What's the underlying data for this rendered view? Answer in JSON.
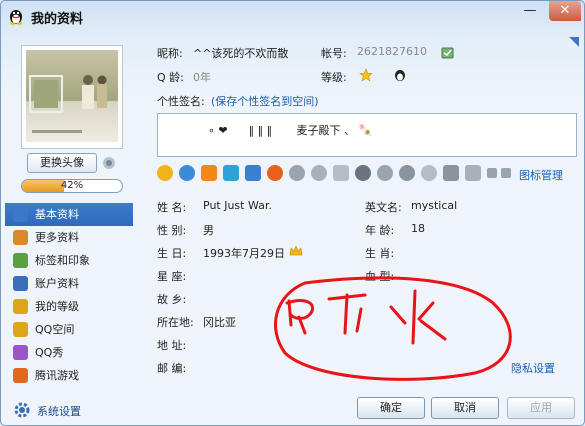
{
  "window": {
    "title": "我的资料"
  },
  "titlebar": {
    "minimize": "—",
    "close": "✕"
  },
  "sidebar": {
    "change_avatar": "更换头像",
    "completion_value": 0.42,
    "completion_text": "42%",
    "items": [
      {
        "label": "基本资料",
        "active": true,
        "icon": "id-card-icon",
        "color": "#3a78c8"
      },
      {
        "label": "更多资料",
        "active": false,
        "icon": "card-icon",
        "color": "#d88a2a"
      },
      {
        "label": "标签和印象",
        "active": false,
        "icon": "tag-icon",
        "color": "#5aa03c"
      },
      {
        "label": "账户资料",
        "active": false,
        "icon": "account-icon",
        "color": "#3a6fb5"
      },
      {
        "label": "我的等级",
        "active": false,
        "icon": "crown-icon",
        "color": "#e0a41a"
      },
      {
        "label": "QQ空间",
        "active": false,
        "icon": "qzone-icon",
        "color": "#e0a41a"
      },
      {
        "label": "QQ秀",
        "active": false,
        "icon": "qqshow-icon",
        "color": "#9a55c8"
      },
      {
        "label": "腾讯游戏",
        "active": false,
        "icon": "game-icon",
        "color": "#e06a1a"
      }
    ],
    "settings_label": "系统设置"
  },
  "profile": {
    "nickname_label": "昵称:",
    "nickname": "^^该死的不欢而散",
    "account_label": "帐号:",
    "account": "2621827610",
    "qage_label": "Q 龄:",
    "qage": "0年",
    "level_label": "等级:",
    "signature_label": "个性签名:",
    "signature_link": "(保存个性签名到空间)",
    "signature_text": "∘ ❤      ‖ ‖ ‖       麦子殿下 、 🍡"
  },
  "icon_manager": "图标管理",
  "fields": {
    "name_label": "姓    名:",
    "name": "Put Just War.",
    "english_label": "英文名:",
    "english": "mystical",
    "gender_label": "性    别:",
    "gender": "男",
    "age_label": "年    龄:",
    "age": "18",
    "birthday_label": "生    日:",
    "birthday": "1993年7月29日",
    "zodiac_label": "生    肖:",
    "zodiac": "",
    "star_label": "星    座:",
    "star": "",
    "blood_label": "血    型:",
    "blood": "",
    "hometown_label": "故    乡:",
    "hometown": "",
    "location_label": "所在地:",
    "location": "冈比亚",
    "address_label": "地    址:",
    "address": "",
    "zip_label": "邮    编:",
    "zip": ""
  },
  "privacy_link": "隐私设置",
  "buttons": {
    "ok": "确定",
    "cancel": "取消",
    "apply": "应用"
  },
  "colors": {
    "accent": "#2e69bb",
    "progress": "#e79a1e",
    "scribble": "#e8141a"
  }
}
